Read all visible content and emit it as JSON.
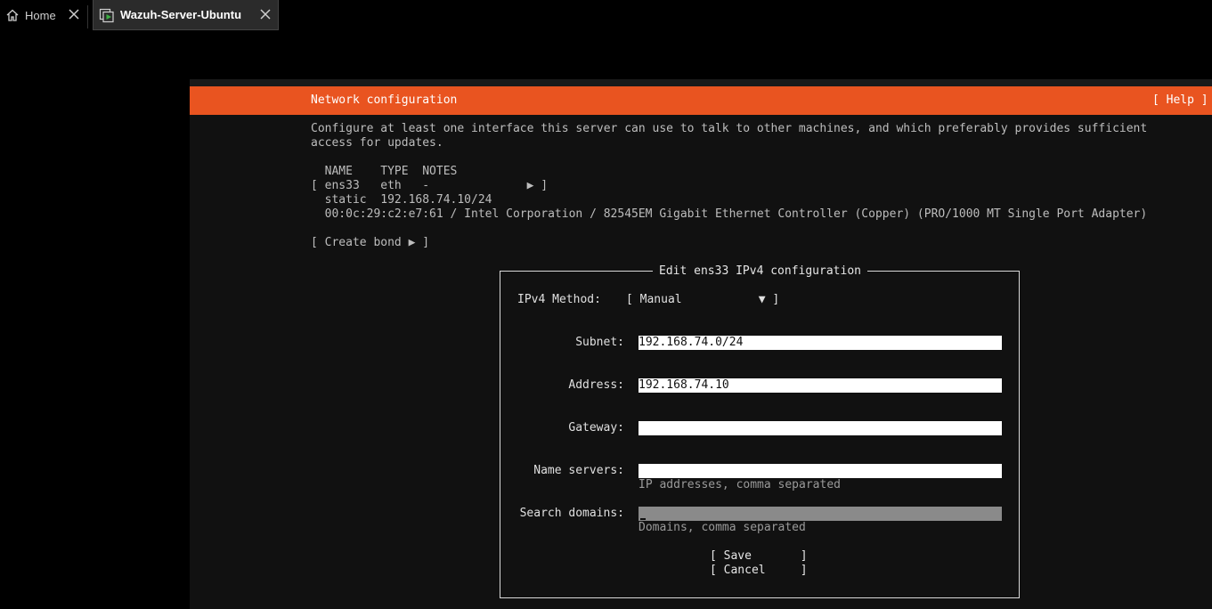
{
  "tabs": {
    "home_label": "Home",
    "vm_label": "Wazuh-Server-Ubuntu"
  },
  "header": {
    "title": "Network configuration",
    "help_label": "[ Help ]",
    "accent_color": "#e95420"
  },
  "intro": {
    "line1": "Configure at least one interface this server can use to talk to other machines, and which preferably provides sufficient",
    "line2": "access for updates."
  },
  "interfaces": {
    "col_header": "  NAME    TYPE  NOTES",
    "row": "[ ens33   eth   -              ▶ ]",
    "static_line": "  static  192.168.74.10/24",
    "hw_line": "  00:0c:29:c2:e7:61 / Intel Corporation / 82545EM Gigabit Ethernet Controller (Copper) (PRO/1000 MT Single Port Adapter)"
  },
  "create_bond_label": "[ Create bond ▶ ]",
  "dialog": {
    "title": "Edit ens33 IPv4 configuration",
    "method_label": "IPv4 Method:",
    "method_value": "[ Manual           ▼ ]",
    "subnet_label": "Subnet:",
    "subnet_value": "192.168.74.0/24",
    "address_label": "Address:",
    "address_value": "192.168.74.10",
    "gateway_label": "Gateway:",
    "gateway_value": "",
    "nameservers_label": "Name servers:",
    "nameservers_value": "",
    "nameservers_hint": "IP addresses, comma separated",
    "searchdomains_label": "Search domains:",
    "searchdomains_value": "",
    "searchdomains_hint": "Domains, comma separated",
    "save_label": "[ Save       ]",
    "cancel_label": "[ Cancel     ]"
  }
}
